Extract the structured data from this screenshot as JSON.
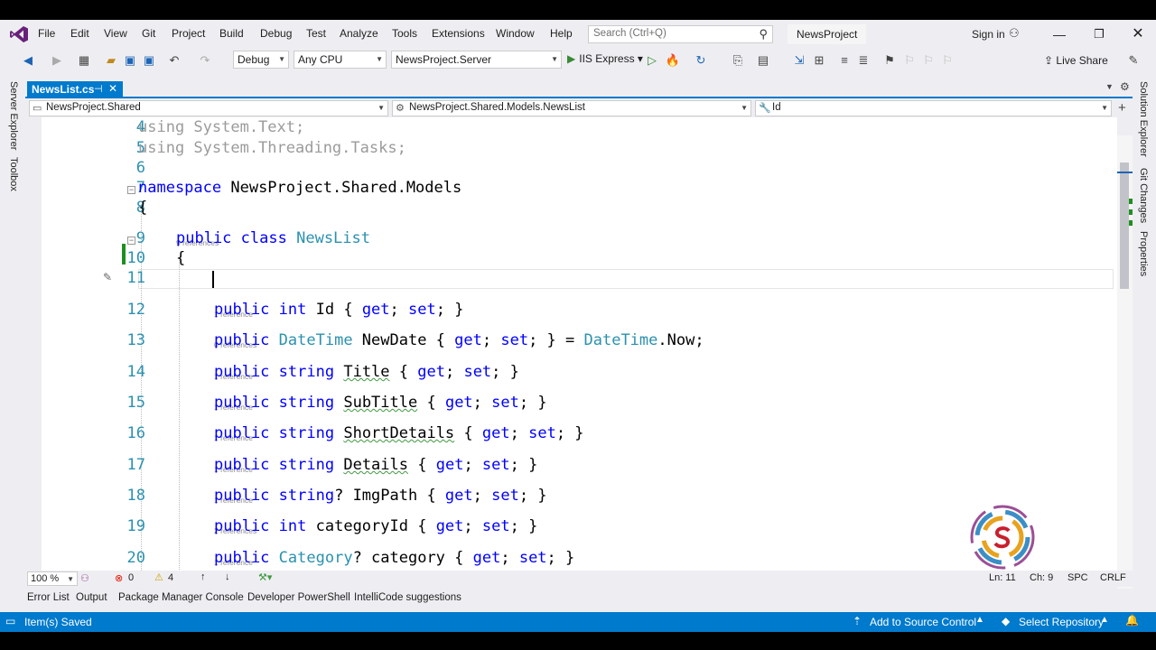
{
  "menu": {
    "items": [
      "File",
      "Edit",
      "View",
      "Git",
      "Project",
      "Build",
      "Debug",
      "Test",
      "Analyze",
      "Tools",
      "Extensions",
      "Window",
      "Help"
    ],
    "search_placeholder": "Search (Ctrl+Q)",
    "project_title": "NewsProject",
    "sign_in": "Sign in"
  },
  "toolbar": {
    "config": "Debug",
    "platform": "Any CPU",
    "startup_project": "NewsProject.Server",
    "run_label": "IIS Express",
    "live_share": "Live Share"
  },
  "side_panels": {
    "left": [
      "Server Explorer",
      "Toolbox"
    ],
    "right": [
      "Solution Explorer",
      "Git Changes",
      "Properties"
    ]
  },
  "tab": {
    "title": "NewsList.cs"
  },
  "navbar": {
    "project": "NewsProject.Shared",
    "type": "NewsProject.Shared.Models.NewsList",
    "member": "Id"
  },
  "code": {
    "lines": [
      {
        "num": "4",
        "text": "using System.Text;"
      },
      {
        "num": "5",
        "text": "using System.Threading.Tasks;"
      },
      {
        "num": "6",
        "text": ""
      },
      {
        "num": "7",
        "text": "namespace NewsProject.Shared.Models"
      },
      {
        "num": "8",
        "text": "{"
      },
      {
        "num": "9",
        "text": "public class NewsList",
        "refs": "9 references"
      },
      {
        "num": "10",
        "text": "{"
      },
      {
        "num": "11",
        "text": ""
      },
      {
        "num": "12",
        "text": "public int Id { get; set; }",
        "refs": "1 reference"
      },
      {
        "num": "13",
        "text": "public DateTime NewDate { get; set; } = DateTime.Now;",
        "refs": "0 references"
      },
      {
        "num": "14",
        "text": "public string Title { get; set; }",
        "refs": "1 reference"
      },
      {
        "num": "15",
        "text": "public string SubTitle { get; set; }",
        "refs": "1 reference"
      },
      {
        "num": "16",
        "text": "public string ShortDetails { get; set; }",
        "refs": "1 reference"
      },
      {
        "num": "17",
        "text": "public string Details { get; set; }",
        "refs": "1 reference"
      },
      {
        "num": "18",
        "text": "public string? ImgPath { get; set; }",
        "refs": "1 reference"
      },
      {
        "num": "19",
        "text": "public int categoryId { get; set; }",
        "refs": "2 references"
      },
      {
        "num": "20",
        "text": "public Category? category { get; set; }",
        "refs": "1 reference"
      }
    ]
  },
  "editor_status": {
    "zoom": "100 %",
    "errors": "0",
    "warnings": "4",
    "line": "Ln: 11",
    "col": "Ch: 9",
    "spacing": "SPC",
    "line_ending": "CRLF"
  },
  "bottom_tabs": [
    "Error List",
    "Output",
    "Package Manager Console",
    "Developer PowerShell",
    "IntelliCode suggestions"
  ],
  "status_bar": {
    "message": "Item(s) Saved",
    "source_control": "Add to Source Control",
    "repository": "Select Repository"
  },
  "colors": {
    "accent": "#007acc",
    "keyword": "#0000ff",
    "type": "#2b91af",
    "line_number": "#2b91af",
    "change_marker": "#1e8f1e"
  }
}
